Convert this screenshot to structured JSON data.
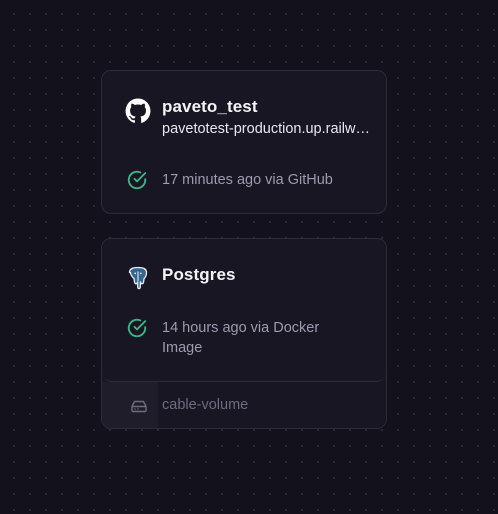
{
  "services": [
    {
      "name": "paveto_test",
      "domain": "pavetotest-production.up.railway.app",
      "status_text": "17 minutes ago via GitHub",
      "icon": "github-icon"
    },
    {
      "name": "Postgres",
      "status_text": "14 hours ago via Docker Image",
      "icon": "postgres-icon",
      "volume": {
        "name": "cable-volume",
        "icon": "volume-icon"
      }
    }
  ],
  "colors": {
    "background": "#13111c",
    "card": "#181622",
    "border": "#2e2b3b",
    "success": "#3eb68c",
    "postgres_blue": "#336791"
  }
}
